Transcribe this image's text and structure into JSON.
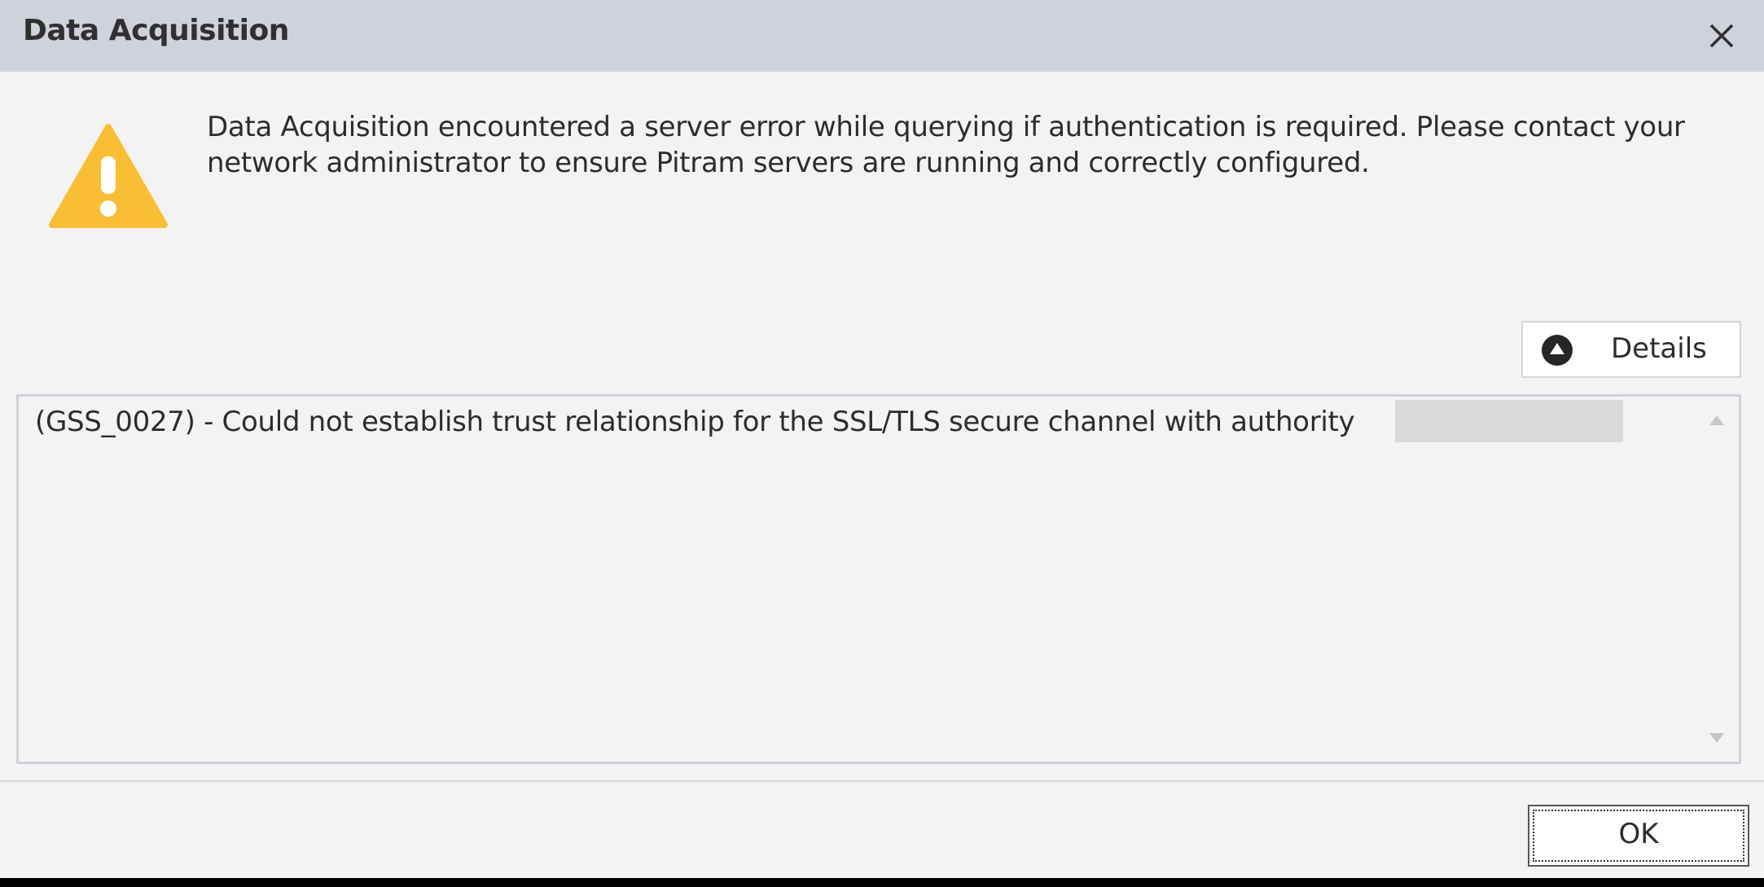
{
  "window": {
    "title": "Data Acquisition",
    "close_icon": "close-icon"
  },
  "message": {
    "icon": "warning-icon",
    "text": "Data Acquisition encountered a server error while querying if authentication is required. Please contact your network administrator to ensure Pitram servers are running and correctly configured."
  },
  "details": {
    "button_label": "Details",
    "button_icon": "collapse-up-icon",
    "text": "(GSS_0027) - Could not establish trust relationship for the SSL/TLS secure channel with authority"
  },
  "footer": {
    "ok_label": "OK"
  },
  "colors": {
    "titlebar": "#cfd1db",
    "dialog_background": "#f3f3f3",
    "warning": "#f9be34",
    "text": "#2c2c2c"
  }
}
